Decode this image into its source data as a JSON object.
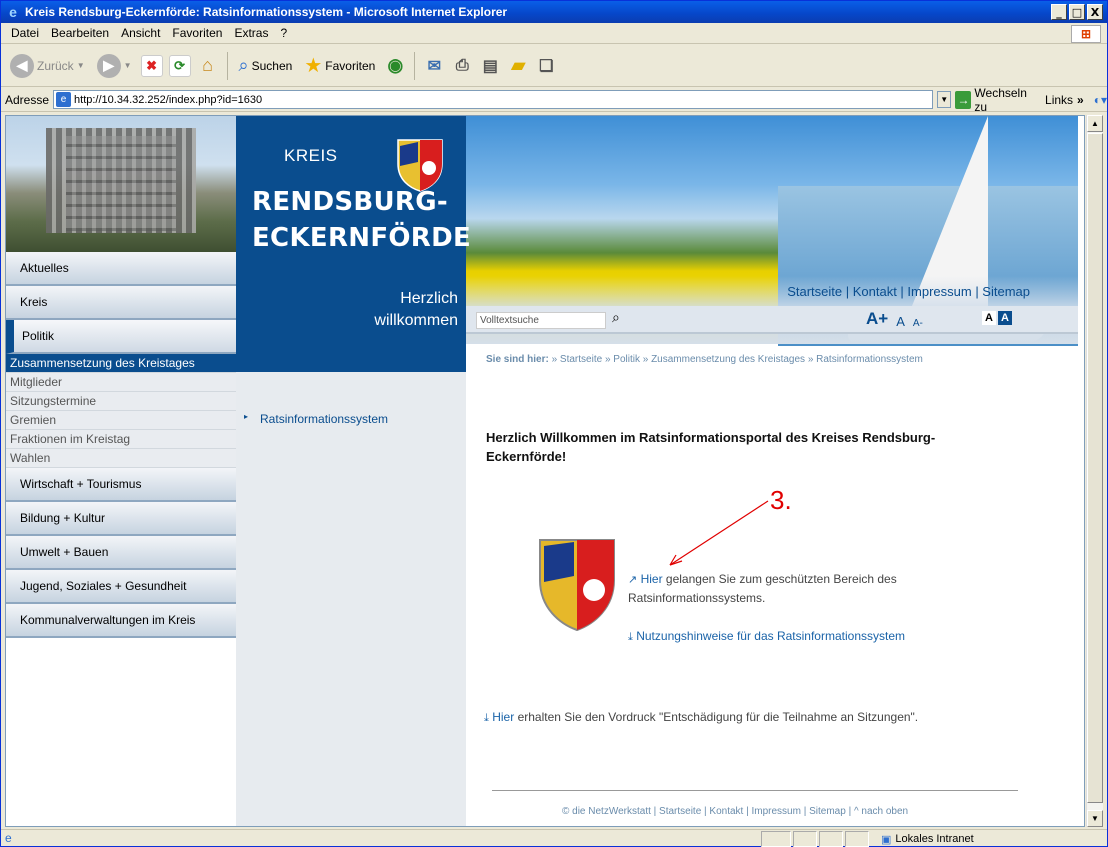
{
  "window": {
    "title": "Kreis Rendsburg-Eckernförde: Ratsinformationssystem - Microsoft Internet Explorer",
    "minimize": "_",
    "maximize": "□",
    "close": "X"
  },
  "menu": [
    "Datei",
    "Bearbeiten",
    "Ansicht",
    "Favoriten",
    "Extras",
    "?"
  ],
  "toolbar": {
    "back": "Zurück",
    "search": "Suchen",
    "favorites": "Favoriten"
  },
  "address": {
    "label": "Adresse",
    "url": "http://10.34.32.252/index.php?id=1630",
    "go": "Wechseln zu",
    "links": "Links"
  },
  "page": {
    "brand_kreis": "KREIS",
    "brand_line1": "RENDSBURG-",
    "brand_line2": "ECKERNFÖRDE",
    "welcome1": "Herzlich",
    "welcome2": "willkommen",
    "toplinks": "Startseite | Kontakt | Impressum | Sitemap",
    "search_placeholder": "Volltextsuche",
    "font_up": "A+",
    "font_norm": "A",
    "font_down": "A-",
    "contrast_a": "A",
    "contrast_b": "A",
    "nav": [
      "Aktuelles",
      "Kreis",
      "Politik",
      "Wirtschaft + Tourismus",
      "Bildung + Kultur",
      "Umwelt + Bauen",
      "Jugend, Soziales + Gesundheit",
      "Kommunalverwaltungen im Kreis"
    ],
    "subnav": [
      "Zusammensetzung des Kreistages",
      "Mitglieder",
      "Sitzungstermine",
      "Gremien",
      "Fraktionen im Kreistag",
      "Wahlen"
    ],
    "mid_link": "Ratsinformationssystem",
    "breadcrumb_label": "Sie sind hier:",
    "breadcrumb": "» Startseite » Politik » Zusammensetzung des Kreistages » Ratsinformationssystem",
    "heading": "Herzlich Willkommen im Ratsinformationsportal des Kreises Rendsburg-Eckernförde!",
    "annotation": "3.",
    "link_hier": "Hier",
    "link_hier_text": "gelangen Sie zum geschützten Bereich des Ratsinformationssystems.",
    "link_hinweise": "Nutzungshinweise für das Ratsinformationssystem",
    "link_hier2": "Hier",
    "vordruck_text": "erhalten Sie den Vordruck \"Entschädigung für die Teilnahme an Sitzungen\".",
    "footer": "© die NetzWerkstatt | Startseite | Kontakt | Impressum | Sitemap | ^ nach oben"
  },
  "status": {
    "zone": "Lokales Intranet"
  }
}
